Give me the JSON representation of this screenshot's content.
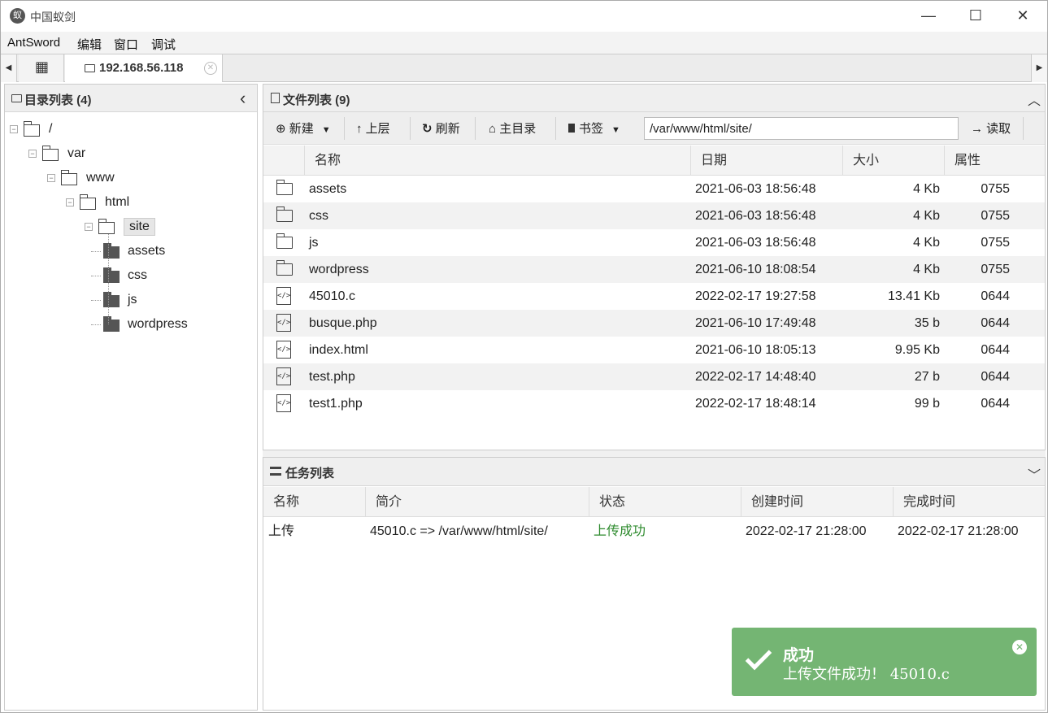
{
  "window": {
    "title": "中国蚁剑",
    "logo_text": "蚁",
    "minimize": "—",
    "maximize": "☐",
    "close": "✕"
  },
  "menu": [
    "AntSword",
    "编辑",
    "窗口",
    "调试"
  ],
  "tabs": {
    "left_arrow": "◀",
    "right_arrow": "▶",
    "home_icon": "▦",
    "host": "192.168.56.118",
    "close": "✕"
  },
  "dir_panel": {
    "title": "目录列表 (4)",
    "collapse": "‹"
  },
  "tree": [
    {
      "label": "/",
      "level": 0,
      "open": true
    },
    {
      "label": "var",
      "level": 1,
      "open": true
    },
    {
      "label": "www",
      "level": 2,
      "open": true
    },
    {
      "label": "html",
      "level": 3,
      "open": true
    },
    {
      "label": "site",
      "level": 4,
      "open": true,
      "selected": true
    },
    {
      "label": "assets",
      "level": 5,
      "open": false
    },
    {
      "label": "css",
      "level": 5,
      "open": false
    },
    {
      "label": "js",
      "level": 5,
      "open": false
    },
    {
      "label": "wordpress",
      "level": 5,
      "open": false
    }
  ],
  "file_panel": {
    "title": "文件列表 (9)",
    "collapse": "︿",
    "toolbar": {
      "new": "新建",
      "up": "上层",
      "refresh": "刷新",
      "home": "主目录",
      "bookmark": "书签",
      "read": "读取",
      "path": "/var/www/html/site/"
    },
    "columns": [
      "名称",
      "日期",
      "大小",
      "属性"
    ],
    "files": [
      {
        "type": "folder",
        "name": "assets",
        "date": "2021-06-03 18:56:48",
        "size": "4 Kb",
        "perm": "0755"
      },
      {
        "type": "folder",
        "name": "css",
        "date": "2021-06-03 18:56:48",
        "size": "4 Kb",
        "perm": "0755"
      },
      {
        "type": "folder",
        "name": "js",
        "date": "2021-06-03 18:56:48",
        "size": "4 Kb",
        "perm": "0755"
      },
      {
        "type": "folder",
        "name": "wordpress",
        "date": "2021-06-10 18:08:54",
        "size": "4 Kb",
        "perm": "0755"
      },
      {
        "type": "file",
        "name": "45010.c",
        "date": "2022-02-17 19:27:58",
        "size": "13.41 Kb",
        "perm": "0644"
      },
      {
        "type": "file",
        "name": "busque.php",
        "date": "2021-06-10 17:49:48",
        "size": "35 b",
        "perm": "0644"
      },
      {
        "type": "file",
        "name": "index.html",
        "date": "2021-06-10 18:05:13",
        "size": "9.95 Kb",
        "perm": "0644"
      },
      {
        "type": "file",
        "name": "test.php",
        "date": "2022-02-17 14:48:40",
        "size": "27 b",
        "perm": "0644"
      },
      {
        "type": "file",
        "name": "test1.php",
        "date": "2022-02-17 18:48:14",
        "size": "99 b",
        "perm": "0644"
      }
    ]
  },
  "task_panel": {
    "title": "任务列表",
    "collapse": "﹀",
    "columns": [
      "名称",
      "简介",
      "状态",
      "创建时间",
      "完成时间"
    ],
    "rows": [
      {
        "name": "上传",
        "desc": "45010.c => /var/www/html/site/",
        "status": "上传成功",
        "created": "2022-02-17 21:28:00",
        "finished": "2022-02-17 21:28:00"
      }
    ],
    "status_color": "#2e8b2e"
  },
  "toast": {
    "title": "成功",
    "message": "上传文件成功！ 45010.c",
    "close": "✕",
    "color": "#74b573"
  }
}
